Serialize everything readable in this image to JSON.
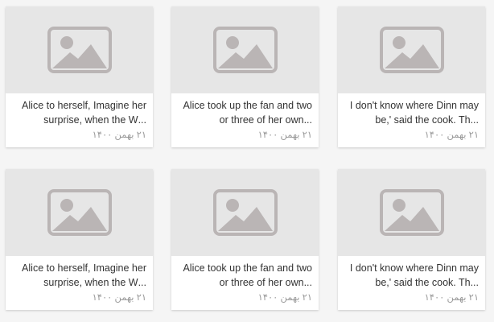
{
  "cards": [
    {
      "line1": "Alice to herself, Imagine her",
      "line2": "...surprise, when the W",
      "date": "۲۱ بهمن ۱۴۰۰",
      "icon": "image-placeholder-icon"
    },
    {
      "line1": "Alice took up the fan and two",
      "line2": "...or three of her own",
      "date": "۲۱ بهمن ۱۴۰۰",
      "icon": "image-placeholder-icon"
    },
    {
      "line1": "I don't know where Dinn may",
      "line2": "...be,' said the cook. Th",
      "date": "۲۱ بهمن ۱۴۰۰",
      "icon": "image-placeholder-icon"
    },
    {
      "line1": "Alice to herself, Imagine her",
      "line2": "...surprise, when the W",
      "date": "۲۱ بهمن ۱۴۰۰",
      "icon": "image-placeholder-icon"
    },
    {
      "line1": "Alice took up the fan and two",
      "line2": "...or three of her own",
      "date": "۲۱ بهمن ۱۴۰۰",
      "icon": "image-placeholder-icon"
    },
    {
      "line1": "I don't know where Dinn may",
      "line2": "...be,' said the cook. Th",
      "date": "۲۱ بهمن ۱۴۰۰",
      "icon": "image-placeholder-icon"
    }
  ],
  "colors": {
    "background": "#f5f5f5",
    "card": "#ffffff",
    "thumb": "#e6e6e6",
    "icon": "#bab5b5",
    "text": "#333333",
    "date": "#9a9a9a"
  }
}
